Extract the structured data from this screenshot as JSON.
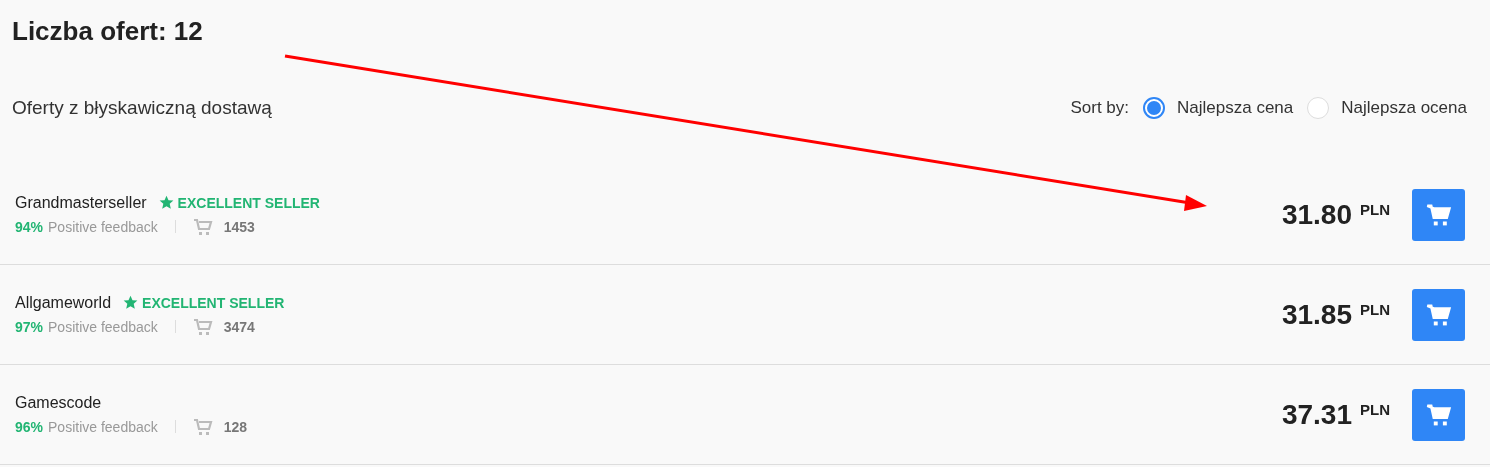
{
  "heading": "Liczba ofert: 12",
  "section_title": "Oferty z błyskawiczną dostawą",
  "sort": {
    "label": "Sort by:",
    "options": [
      {
        "label": "Najlepsza cena",
        "selected": true
      },
      {
        "label": "Najlepsza ocena",
        "selected": false
      }
    ]
  },
  "offers": [
    {
      "seller": "Grandmasterseller",
      "badge": "EXCELLENT SELLER",
      "rating": "94%",
      "feedback_label": "Positive feedback",
      "sales": "1453",
      "price": "31.80",
      "currency": "PLN"
    },
    {
      "seller": "Allgameworld",
      "badge": "EXCELLENT SELLER",
      "rating": "97%",
      "feedback_label": "Positive feedback",
      "sales": "3474",
      "price": "31.85",
      "currency": "PLN"
    },
    {
      "seller": "Gamescode",
      "rating": "96%",
      "feedback_label": "Positive feedback",
      "sales": "128",
      "price": "37.31",
      "currency": "PLN"
    }
  ]
}
